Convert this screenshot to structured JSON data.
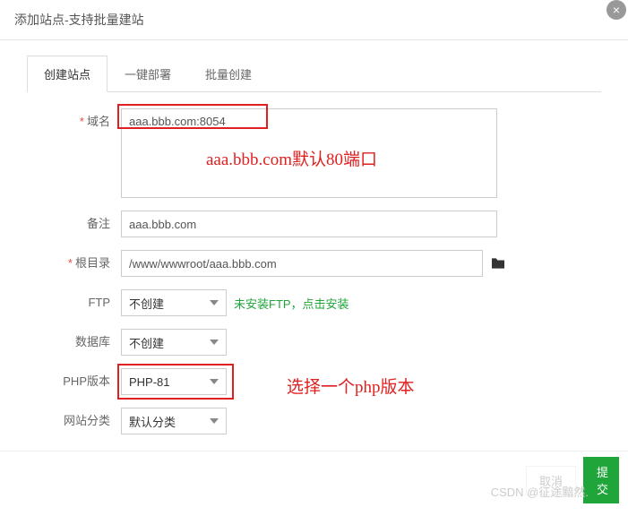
{
  "header": {
    "title": "添加站点-支持批量建站"
  },
  "tabs": {
    "create": "创建站点",
    "deploy": "一键部署",
    "batch": "批量创建"
  },
  "form": {
    "domain_label": "域名",
    "domain_value": "aaa.bbb.com:8054",
    "remark_label": "备注",
    "remark_value": "aaa.bbb.com",
    "root_label": "根目录",
    "root_value": "/www/wwwroot/aaa.bbb.com",
    "ftp_label": "FTP",
    "ftp_value": "不创建",
    "ftp_hint": "未安装FTP，点击安装",
    "db_label": "数据库",
    "db_value": "不创建",
    "php_label": "PHP版本",
    "php_value": "PHP-81",
    "cat_label": "网站分类",
    "cat_value": "默认分类"
  },
  "annotations": {
    "domain_note": "aaa.bbb.com默认80端口",
    "php_note": "选择一个php版本"
  },
  "footer": {
    "cancel": "取消",
    "submit": "提交"
  },
  "watermark": "CSDN @征途黯然."
}
